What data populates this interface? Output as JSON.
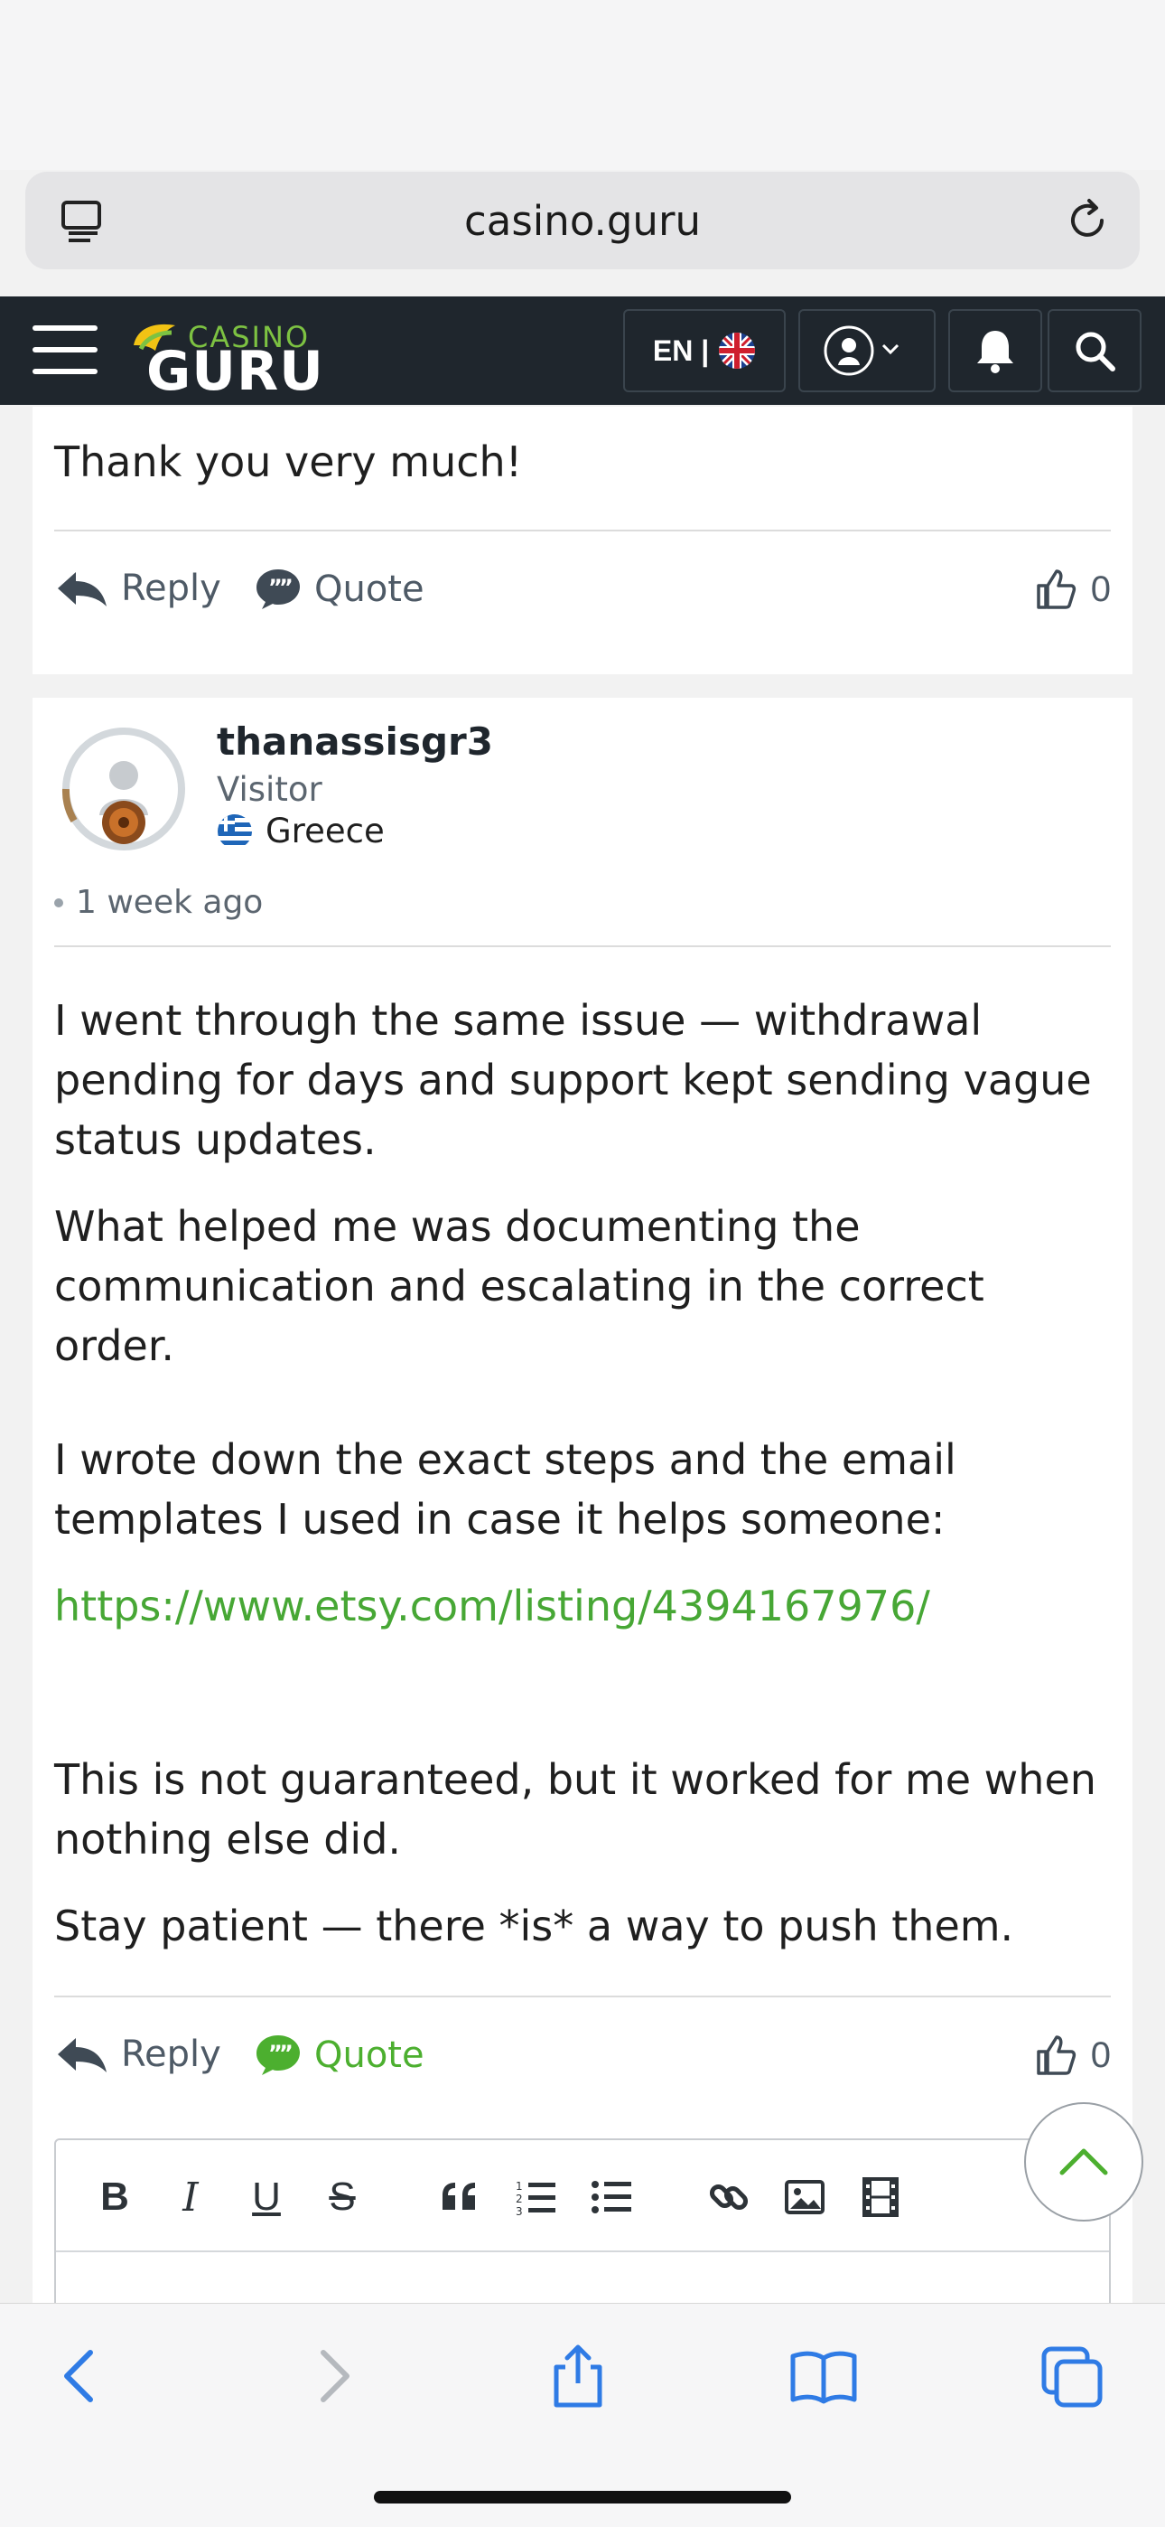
{
  "browser": {
    "url": "casino.guru"
  },
  "header": {
    "logo_top": "CASINO",
    "logo_bottom": "GURU",
    "lang_label": "EN |"
  },
  "post1": {
    "text": "Thank you very much!",
    "reply_label": "Reply",
    "quote_label": "Quote",
    "likes": "0"
  },
  "post2": {
    "username": "thanassisgr3",
    "role": "Visitor",
    "country": "Greece",
    "time": "1 week ago",
    "para1": "I went through the same issue — withdrawal pending for days and support kept sending vague status updates.",
    "para2": "What helped me was documenting the communication and escalating in the correct order.",
    "para3": "I wrote down the exact steps and the email templates I used in case it helps someone:",
    "link": "https://www.etsy.com/listing/4394167976/",
    "para4": "This is not guaranteed, but it worked for me when nothing else did.",
    "para5": "Stay patient — there *is* a way to push them.",
    "reply_label": "Reply",
    "quote_label": "Quote",
    "likes": "0"
  },
  "editor_toolbar": {
    "bold": "B",
    "italic": "I",
    "underline": "U",
    "strike": "S"
  },
  "colors": {
    "nav_bg": "#1f262d",
    "accent_green": "#4caf2f",
    "link_green": "#47a735"
  }
}
